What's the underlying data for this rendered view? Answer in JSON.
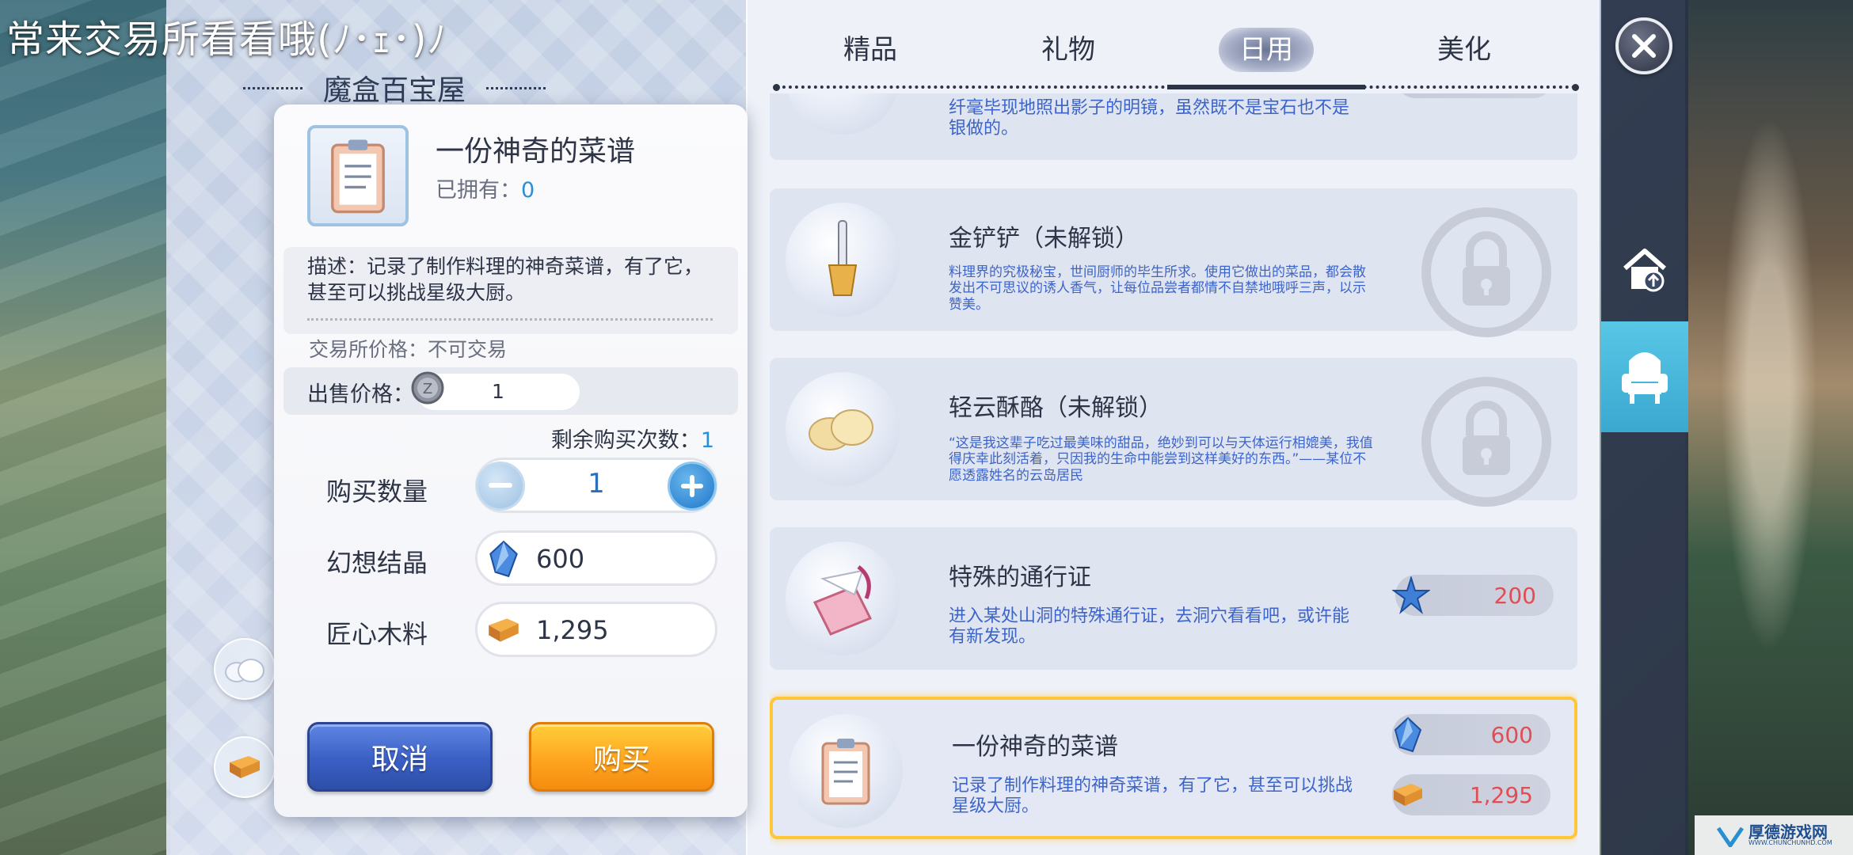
{
  "hint_banner": "常来交易所看看哦(ﾉ･ｪ･)ﾉ",
  "shop_title": "魔盒百宝屋",
  "tabs": [
    {
      "label": "精品",
      "active": false
    },
    {
      "label": "礼物",
      "active": false
    },
    {
      "label": "日用",
      "active": true
    },
    {
      "label": "美化",
      "active": false
    }
  ],
  "catalog": {
    "partial_item": {
      "desc": "纤毫毕现地照出影子的明镜，虽然既不是宝石也不是银做的。"
    },
    "items": [
      {
        "name": "金铲铲（未解锁）",
        "desc": "料理界的究极秘宝，世间厨师的毕生所求。使用它做出的菜品，都会散发出不可思议的诱人香气，让每位品尝者都情不自禁地哦呼三声，以示赞美。",
        "locked": true
      },
      {
        "name": "轻云酥酪（未解锁）",
        "desc": "“这是我这辈子吃过最美味的甜品，绝妙到可以与天体运行相媲美，我值得庆幸此刻活着，只因我的生命中能尝到这样美好的东西。”——某位不愿透露姓名的云岛居民",
        "locked": true
      },
      {
        "name": "特殊的通行证",
        "desc": "进入某处山洞的特殊通行证，去洞穴看看吧，或许能有新发现。",
        "price_icon": "blue-star-crystal-icon",
        "price": "200"
      },
      {
        "name": "一份神奇的菜谱",
        "desc": "记录了制作料理的神奇菜谱，有了它，甚至可以挑战星级大厨。",
        "prices": [
          {
            "icon": "fantasy-crystal-icon",
            "value": "600"
          },
          {
            "icon": "wood-material-icon",
            "value": "1,295"
          }
        ],
        "selected": true
      }
    ]
  },
  "dialog": {
    "item_name": "一份神奇的菜谱",
    "owned_label": "已拥有：",
    "owned_count": "0",
    "description": "描述：记录了制作料理的神奇菜谱，有了它，甚至可以挑战星级大厨。",
    "trade_price": "交易所价格：不可交易",
    "sell_label": "出售价格：",
    "sell_value": "1",
    "remaining_label": "剩余购买次数：",
    "remaining_count": "1",
    "quantity_label": "购买数量",
    "quantity_value": "1",
    "cost1_label": "幻想结晶",
    "cost1_value": "600",
    "cost2_label": "匠心木料",
    "cost2_value": "1,295",
    "cancel_label": "取消",
    "buy_label": "购买"
  },
  "watermark": {
    "title": "厚德游戏网",
    "url": "WWW.CHUNCHUNHD.COM"
  },
  "colors": {
    "accent_gold": "#ffc638",
    "price_red": "#e14d54",
    "desc_blue": "#3d64c8",
    "count_blue": "#2b8fd6",
    "cancel_blue": "#3a5fc4",
    "buy_orange": "#ffa51f"
  }
}
